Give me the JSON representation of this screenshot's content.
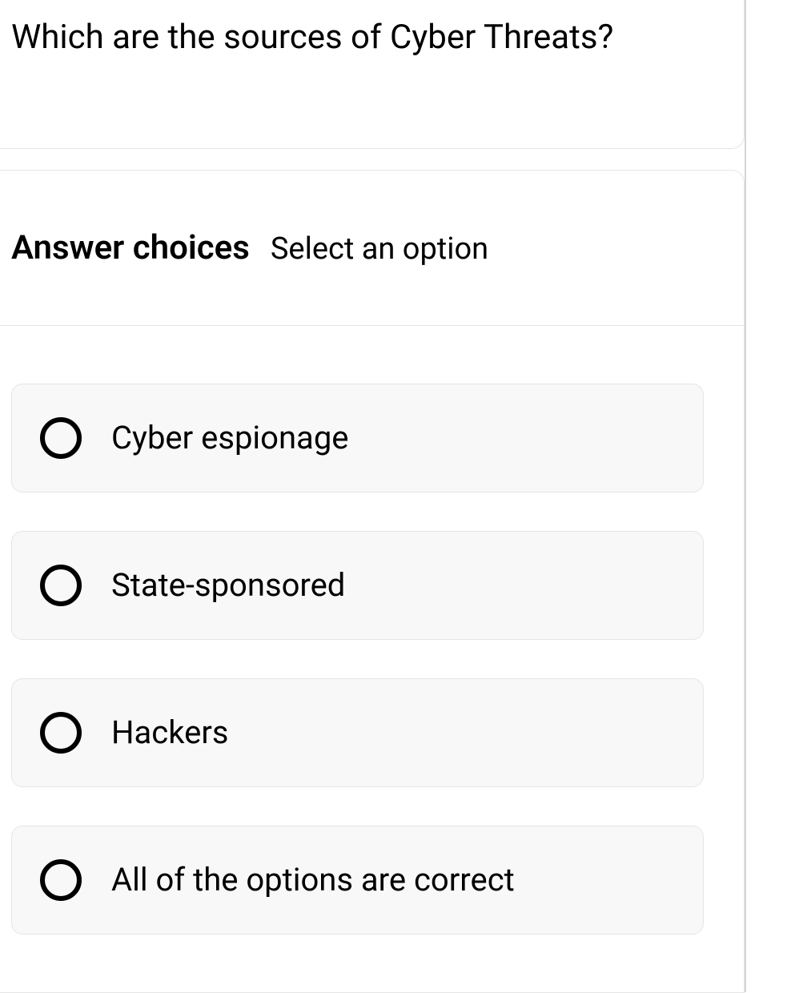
{
  "question": {
    "text": "Which are the sources of Cyber Threats?"
  },
  "answer_section": {
    "title": "Answer choices",
    "subtitle": "Select an option"
  },
  "options": [
    {
      "label": "Cyber espionage"
    },
    {
      "label": "State-sponsored"
    },
    {
      "label": "Hackers"
    },
    {
      "label": "All of the options are correct"
    }
  ]
}
